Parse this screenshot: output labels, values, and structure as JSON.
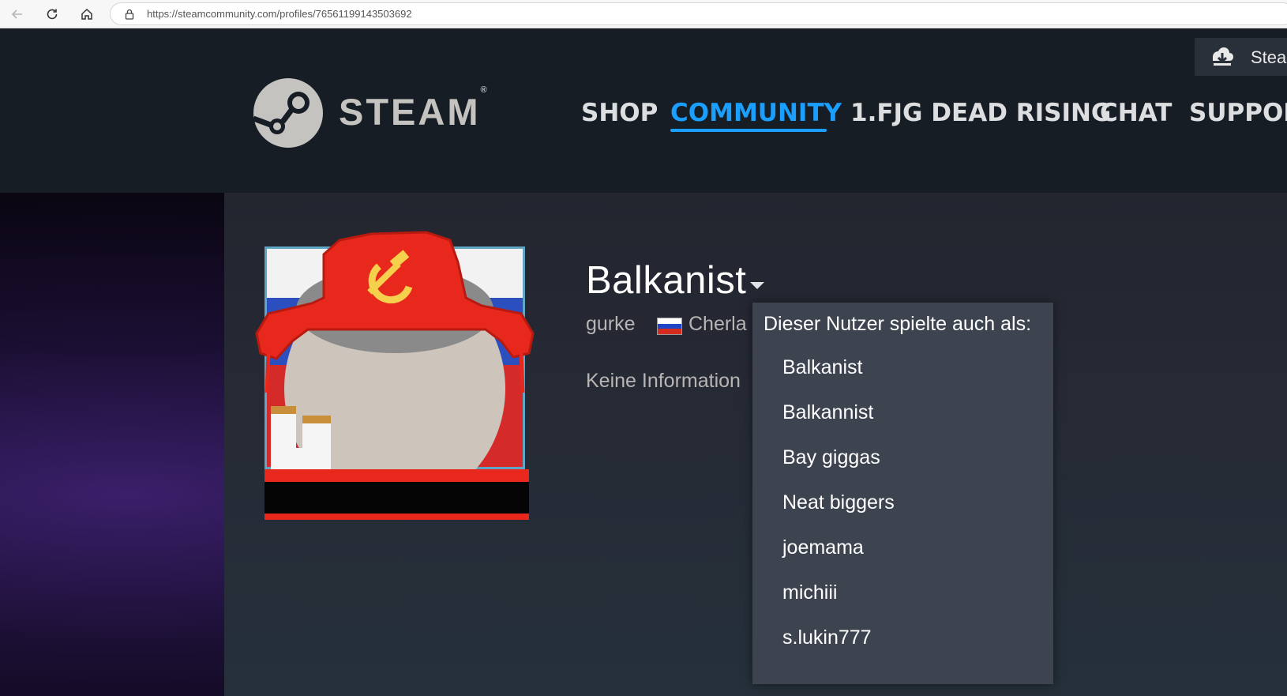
{
  "browser": {
    "url": "https://steamcommunity.com/profiles/76561199143503692"
  },
  "header": {
    "wordmark": "STEAM",
    "registered_mark": "®",
    "nav": [
      "SHOP",
      "COMMUNITY",
      "1.FJG DEAD RISING",
      "CHAT",
      "SUPPOR"
    ],
    "active_nav": "COMMUNITY",
    "install_label": "Stea",
    "accent_color": "#1a9fff"
  },
  "profile": {
    "persona_name": "Balkanist",
    "real_name": "gurke",
    "location": "Cherla",
    "summary": "Keine Information",
    "flag": "ru"
  },
  "aliases": {
    "title": "Dieser Nutzer spielte auch als:",
    "items": [
      "Balkanist",
      "Balkannist",
      "Bay giggas",
      "Neat biggers",
      "joemama",
      "michiii",
      "s.lukin777"
    ]
  }
}
